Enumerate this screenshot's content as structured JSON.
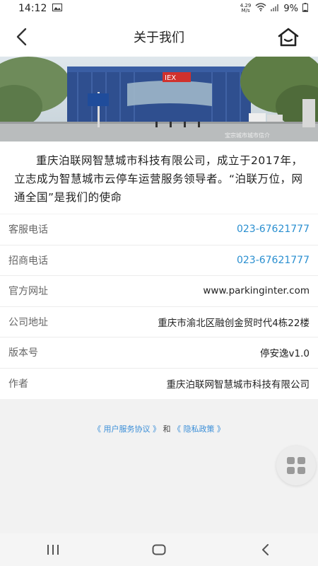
{
  "status_bar": {
    "time": "14:12",
    "net_speed_value": "4.29",
    "net_speed_unit": "M/s",
    "battery": "9%"
  },
  "header": {
    "title": "关于我们",
    "back_icon": "chevron-left-icon",
    "home_icon": "home-icon"
  },
  "banner": {
    "sign_text": "IEX",
    "watermark": "宝宗城市城市信介"
  },
  "intro": {
    "text": "重庆泊联网智慧城市科技有限公司，成立于2017年，立志成为智慧城市云停车运营服务领导者。“泊联万位，网通全国”是我们的使命"
  },
  "info": [
    {
      "label": "客服电话",
      "value": "023-67621777",
      "link": true
    },
    {
      "label": "招商电话",
      "value": "023-67621777",
      "link": true
    },
    {
      "label": "官方网址",
      "value": "www.parkinginter.com",
      "link": false
    },
    {
      "label": "公司地址",
      "value": "重庆市渝北区融创金贸时代4栋22楼",
      "link": false
    },
    {
      "label": "版本号",
      "value": "停安逸v1.0",
      "link": false
    },
    {
      "label": "作者",
      "value": "重庆泊联网智慧城市科技有限公司",
      "link": false
    }
  ],
  "agreements": {
    "user_agreement": "《 用户服务协议 》",
    "and": " 和 ",
    "privacy_policy": "《 隐私政策 》"
  },
  "colors": {
    "link": "#2a8fd0",
    "background": "#f2f2f2"
  }
}
